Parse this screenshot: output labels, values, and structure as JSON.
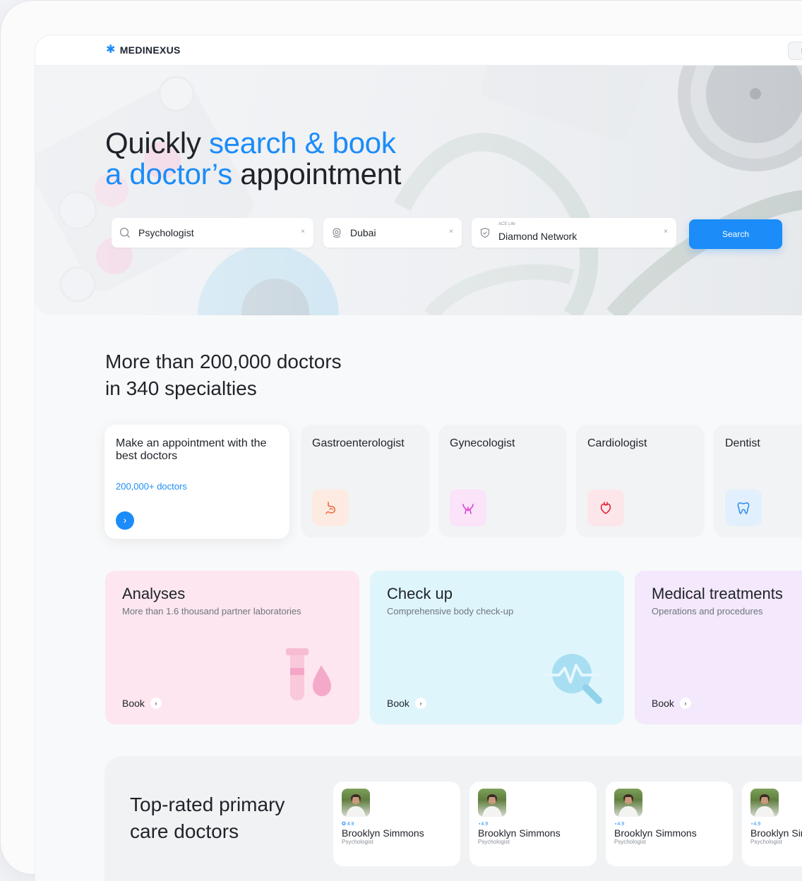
{
  "brand": {
    "name": "MEDINEXUS",
    "accent": "#1b8cf8"
  },
  "topbar": {
    "button_label": "L"
  },
  "hero": {
    "title_part1": "Quickly ",
    "title_accent1": "search & book",
    "title_accent2": "a doctor’s",
    "title_part2": " appointment"
  },
  "search": {
    "specialty": {
      "value": "Psychologist",
      "clear": "×",
      "icon": "search-icon"
    },
    "location": {
      "value": "Dubai",
      "clear": "×",
      "icon": "location-pin-icon"
    },
    "insurance": {
      "caption": "ACE Life",
      "value": "Diamond Network",
      "clear": "×",
      "icon": "shield-icon"
    },
    "button_label": "Search"
  },
  "doctors_section": {
    "title_line1": "More than 200,000 doctors",
    "title_line2": "in 340 specialties"
  },
  "specialties": {
    "main": {
      "title": "Make an appointment with the best doctors",
      "count": "200,000+ doctors",
      "arrow": "›"
    },
    "items": [
      {
        "label": "Gastroenterologist",
        "icon": "stomach-icon",
        "color": "#f06a3a"
      },
      {
        "label": "Gynecologist",
        "icon": "uterus-icon",
        "color": "#d93bd0"
      },
      {
        "label": "Cardiologist",
        "icon": "heart-icon",
        "color": "#e0243c"
      },
      {
        "label": "Dentist",
        "icon": "tooth-icon",
        "color": "#2a8cf0"
      }
    ]
  },
  "services": [
    {
      "title": "Analyses",
      "subtitle": "More than 1.6 thousand partner laboratories",
      "book": "Book",
      "color": "#fde6ef",
      "icon": "test-tube-icon"
    },
    {
      "title": "Check up",
      "subtitle": "Comprehensive body check-up",
      "book": "Book",
      "color": "#def5fb",
      "icon": "magnifier-pulse-icon"
    },
    {
      "title": "Medical treatments",
      "subtitle": "Operations and procedures",
      "book": "Book",
      "color": "#f3e8fc",
      "icon": ""
    }
  ],
  "top_rated": {
    "title_line1": "Top-rated primary",
    "title_line2": "care doctors",
    "doctors": [
      {
        "rating": "✪ 4.9",
        "name": "Brooklyn Simmons",
        "role": "Psychologist"
      },
      {
        "rating": "⋆4.9",
        "name": "Brooklyn Simmons",
        "role": "Psychologist"
      },
      {
        "rating": "⋆4.9",
        "name": "Brooklyn Simmons",
        "role": "Psychologist"
      },
      {
        "rating": "⋆4.9",
        "name": "Brooklyn Simmons",
        "role": "Psychologist"
      }
    ]
  }
}
